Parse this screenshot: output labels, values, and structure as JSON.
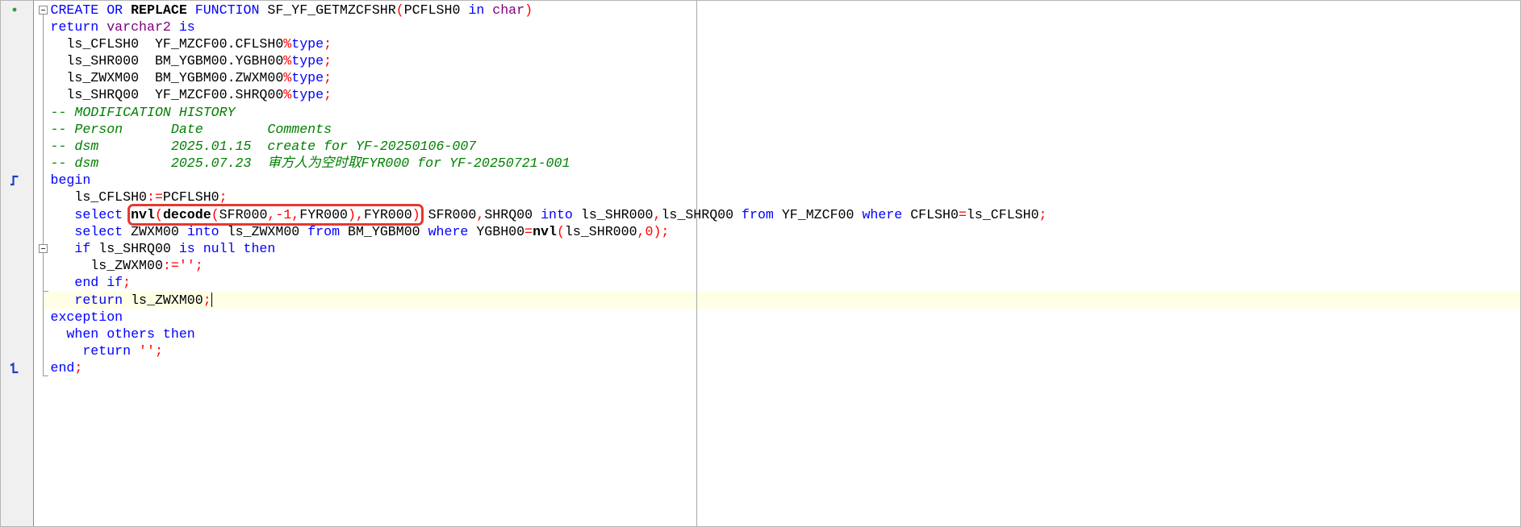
{
  "colors": {
    "keyword": "#0000ff",
    "identifier": "#000000",
    "function": "#000000",
    "datatype": "#800080",
    "symbol": "#ff0000",
    "number": "#ff0000",
    "string": "#ff0000",
    "comment": "#008000",
    "current_line": "#ffffe6",
    "annotation": "#e5392f",
    "margin_line": "#a8a8a8"
  },
  "editor": {
    "lines": [
      {
        "marker": "green-dot-icon",
        "fold": "fold-minus-icon",
        "tokens": [
          {
            "kw": "CREATE OR "
          },
          {
            "fn": "REPLACE"
          },
          {
            "kw": " FUNCTION"
          },
          {
            "id": " SF_YF_GETMZCFSHR"
          },
          {
            "sym": "("
          },
          {
            "id": "PCFLSH0 "
          },
          {
            "kw": "in "
          },
          {
            "ty": "char"
          },
          {
            "sym": ")"
          }
        ]
      },
      {
        "tokens": [
          {
            "kw": "return "
          },
          {
            "ty": "varchar2"
          },
          {
            "kw": " is"
          }
        ]
      },
      {
        "tokens": [
          {
            "id": "  ls_CFLSH0  YF_MZCF00.CFLSH0"
          },
          {
            "sym": "%"
          },
          {
            "kw": "type"
          },
          {
            "sym": ";"
          }
        ]
      },
      {
        "tokens": [
          {
            "id": "  ls_SHR000  BM_YGBM00.YGBH00"
          },
          {
            "sym": "%"
          },
          {
            "kw": "type"
          },
          {
            "sym": ";"
          }
        ]
      },
      {
        "tokens": [
          {
            "id": "  ls_ZWXM00  BM_YGBM00.ZWXM00"
          },
          {
            "sym": "%"
          },
          {
            "kw": "type"
          },
          {
            "sym": ";"
          }
        ]
      },
      {
        "tokens": [
          {
            "id": "  ls_SHRQ00  YF_MZCF00.SHRQ00"
          },
          {
            "sym": "%"
          },
          {
            "kw": "type"
          },
          {
            "sym": ";"
          }
        ]
      },
      {
        "tokens": [
          {
            "cm": "-- MODIFICATION HISTORY"
          }
        ]
      },
      {
        "tokens": [
          {
            "cm": "-- Person      Date        Comments"
          }
        ]
      },
      {
        "tokens": [
          {
            "cm": "-- dsm         2025.01.15  create for YF-20250106-007"
          }
        ]
      },
      {
        "tokens": [
          {
            "cm": "-- dsm         2025.07.23  审方人为空时取FYR000 for YF-20250721-001"
          }
        ]
      },
      {
        "marker": "block-begin-icon",
        "tokens": [
          {
            "kw": "begin"
          }
        ]
      },
      {
        "tokens": [
          {
            "id": "   ls_CFLSH0"
          },
          {
            "sym": ":="
          },
          {
            "id": "PCFLSH0"
          },
          {
            "sym": ";"
          }
        ]
      },
      {
        "tokens": [
          {
            "kw": "   select "
          },
          {
            "box": [
              {
                "fn": "nvl"
              },
              {
                "sym": "("
              },
              {
                "fn": "decode"
              },
              {
                "sym": "("
              },
              {
                "id": "SFR000"
              },
              {
                "sym": ","
              },
              {
                "num": "-1"
              },
              {
                "sym": ","
              },
              {
                "id": "FYR000"
              },
              {
                "sym": "),"
              },
              {
                "id": "FYR000"
              },
              {
                "sym": ")"
              }
            ]
          },
          {
            "id": " SFR000"
          },
          {
            "sym": ","
          },
          {
            "id": "SHRQ00 "
          },
          {
            "kw": "into "
          },
          {
            "id": "ls_SHR000"
          },
          {
            "sym": ","
          },
          {
            "id": "ls_SHRQ00 "
          },
          {
            "kw": "from "
          },
          {
            "id": "YF_MZCF00 "
          },
          {
            "kw": "where "
          },
          {
            "id": "CFLSH0"
          },
          {
            "sym": "="
          },
          {
            "id": "ls_CFLSH0"
          },
          {
            "sym": ";"
          }
        ]
      },
      {
        "tokens": [
          {
            "kw": "   select "
          },
          {
            "id": "ZWXM00 "
          },
          {
            "kw": "into "
          },
          {
            "id": "ls_ZWXM00 "
          },
          {
            "kw": "from "
          },
          {
            "id": "BM_YGBM00 "
          },
          {
            "kw": "where "
          },
          {
            "id": "YGBH00"
          },
          {
            "sym": "="
          },
          {
            "fn": "nvl"
          },
          {
            "sym": "("
          },
          {
            "id": "ls_SHR000"
          },
          {
            "sym": ","
          },
          {
            "num": "0"
          },
          {
            "sym": ");"
          }
        ]
      },
      {
        "fold": "fold-minus-icon",
        "tokens": [
          {
            "kw": "   if "
          },
          {
            "id": "ls_SHRQ00 "
          },
          {
            "kw": "is null then"
          }
        ]
      },
      {
        "tokens": [
          {
            "id": "     ls_ZWXM00"
          },
          {
            "sym": ":="
          },
          {
            "str": "''"
          },
          {
            "sym": ";"
          }
        ]
      },
      {
        "fold_end": true,
        "tokens": [
          {
            "kw": "   end if"
          },
          {
            "sym": ";"
          }
        ]
      },
      {
        "current": true,
        "tokens": [
          {
            "kw": "   return "
          },
          {
            "id": "ls_ZWXM00"
          },
          {
            "sym": ";"
          }
        ]
      },
      {
        "tokens": [
          {
            "kw": "exception"
          }
        ]
      },
      {
        "tokens": [
          {
            "kw": "  when others then"
          }
        ]
      },
      {
        "tokens": [
          {
            "kw": "    return "
          },
          {
            "str": "''"
          },
          {
            "sym": ";"
          }
        ]
      },
      {
        "marker": "block-end-icon",
        "fold_end": true,
        "tokens": [
          {
            "kw": "end"
          },
          {
            "sym": ";"
          }
        ]
      }
    ]
  }
}
